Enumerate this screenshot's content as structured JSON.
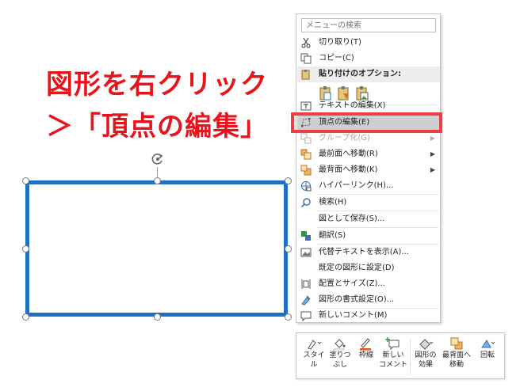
{
  "caption": {
    "line1": "図形を右クリック",
    "line2": "＞「頂点の編集」"
  },
  "colors": {
    "caption": "#e8141b",
    "shape_border": "#1d70c2",
    "highlight_box": "#ea3f45"
  },
  "menu": {
    "search_placeholder": "メニューの検索",
    "items": [
      {
        "label": "切り取り(T)",
        "icon": "scissors-icon"
      },
      {
        "label": "コピー(C)",
        "icon": "copy-icon"
      },
      {
        "label": "貼り付けのオプション:",
        "icon": "paste-options-icon"
      },
      {
        "label": "テキストの編集(X)",
        "icon": "text-edit-icon"
      },
      {
        "label": "頂点の編集(E)",
        "icon": "edit-points-icon"
      },
      {
        "label": "グループ化(G)",
        "icon": "group-icon"
      },
      {
        "label": "最前面へ移動(R)",
        "icon": "bring-front-icon"
      },
      {
        "label": "最背面へ移動(K)",
        "icon": "send-back-icon"
      },
      {
        "label": "ハイパーリンク(H)...",
        "icon": "link-icon"
      },
      {
        "label": "検索(H)",
        "icon": "search-icon"
      },
      {
        "label": "図として保存(S)...",
        "icon": ""
      },
      {
        "label": "翻訳(S)",
        "icon": "translate-icon"
      },
      {
        "label": "代替テキストを表示(A)...",
        "icon": "alt-text-icon"
      },
      {
        "label": "既定の図形に設定(D)",
        "icon": ""
      },
      {
        "label": "配置とサイズ(Z)...",
        "icon": "size-position-icon"
      },
      {
        "label": "図形の書式設定(O)...",
        "icon": "format-shape-icon"
      },
      {
        "label": "新しいコメント(M)",
        "icon": "comment-icon"
      }
    ]
  },
  "toolbar": {
    "style_1": "スタイ",
    "style_2": "ル",
    "fill_1": "塗りつ",
    "fill_2": "ぶし",
    "outline": "枠線",
    "comment_1": "新しい",
    "comment_2": "コメント",
    "effects_1": "図形の",
    "effects_2": "効果",
    "back_1": "最背面へ",
    "back_2": "移動",
    "rotate": "回転"
  }
}
